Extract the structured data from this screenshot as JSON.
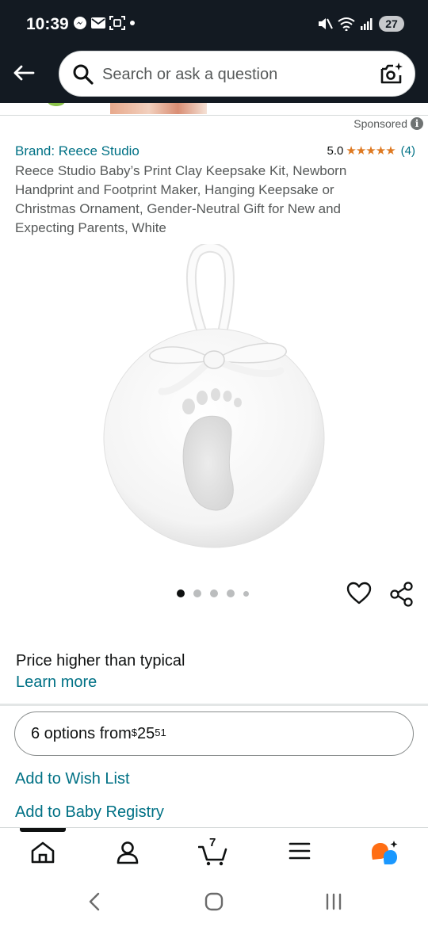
{
  "status_bar": {
    "time": "10:39",
    "battery": "27"
  },
  "search": {
    "placeholder": "Search or ask a question"
  },
  "ad": {
    "sponsored_label": "Sponsored"
  },
  "product": {
    "brand": "Brand: Reece Studio",
    "rating": "5.0",
    "stars": "★★★★★",
    "review_count": "(4)",
    "title": "Reece Studio Baby’s Print Clay Keepsake Kit, Newborn Handprint and Footprint Maker, Hanging Keepsake or Christmas Ornament, Gender-Neutral Gift for New and Expecting Parents, White",
    "image_count": 5,
    "active_image": 1
  },
  "pricing": {
    "note": "Price higher than typical",
    "learn_more": "Learn more",
    "options_prefix": "6 options from ",
    "currency": "$",
    "price_whole": "25",
    "price_fraction": "51"
  },
  "actions": {
    "wish_list": "Add to Wish List",
    "registry": "Add to Baby Registry"
  },
  "bottom_nav": {
    "cart_count": "7",
    "items": [
      "home",
      "account",
      "cart",
      "menu",
      "rufus"
    ]
  },
  "colors": {
    "header_bg": "#131a22",
    "link": "#007185",
    "star": "#de7921",
    "rufus_orange": "#ff6e14",
    "rufus_blue": "#1a98ff"
  }
}
